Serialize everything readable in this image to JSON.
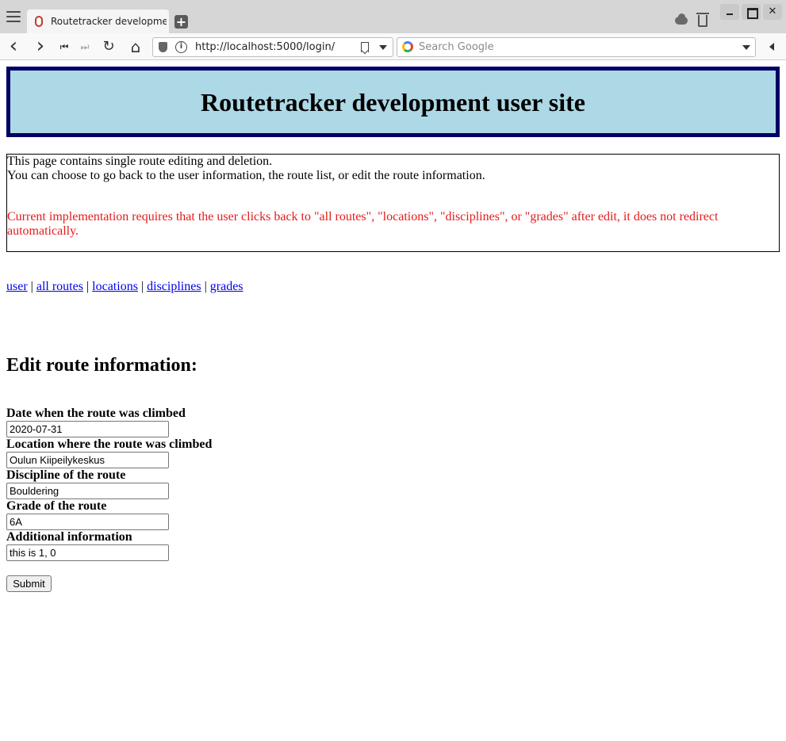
{
  "browser": {
    "tab_title": "Routetracker development",
    "new_tab_label": "+",
    "url": "http://localhost:5000/login/",
    "search_placeholder": "Search Google",
    "info_symbol": "i"
  },
  "nav": {
    "back_glyph": "‹",
    "forward_glyph": "›",
    "first_glyph": "⏮",
    "last_glyph": "⏭",
    "reload_glyph": "↻",
    "home_glyph": "⌂"
  },
  "header": {
    "title": "Routetracker development user site"
  },
  "info": {
    "line1": "This page contains single route editing and deletion.",
    "line2": "You can choose to go back to the user information, the route list, or edit the route information.",
    "warning": "Current implementation requires that the user clicks back to \"all routes\", \"locations\", \"disciplines\", or \"grades\" after edit, it does not redirect automatically."
  },
  "links": {
    "items": [
      "user",
      "all routes",
      "locations",
      "disciplines",
      "grades"
    ],
    "separator": "|"
  },
  "form": {
    "heading": "Edit route information:",
    "fields": [
      {
        "label": "Date when the route was climbed",
        "value": "2020-07-31"
      },
      {
        "label": "Location where the route was climbed",
        "value": "Oulun Kiipeilykeskus"
      },
      {
        "label": "Discipline of the route",
        "value": "Bouldering"
      },
      {
        "label": "Grade of the route",
        "value": "6A"
      },
      {
        "label": "Additional information",
        "value": "this is 1, 0"
      }
    ],
    "submit_label": "Submit"
  }
}
